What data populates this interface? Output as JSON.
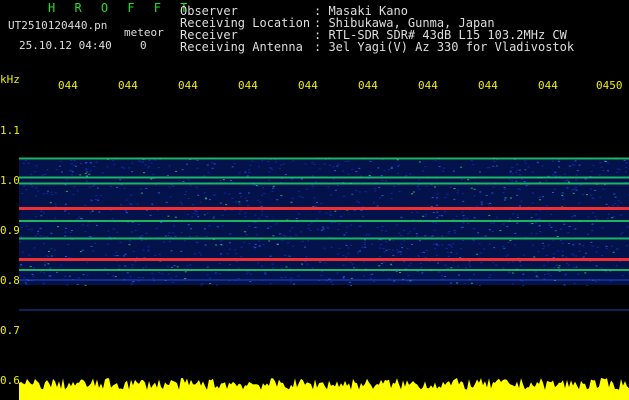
{
  "header": {
    "app_name": "H R O F F T",
    "filename": "UT2510120440.pn",
    "tag": "meteor",
    "datetime": "25.10.12 04:40",
    "count": "0"
  },
  "meta": [
    {
      "key": "Observer",
      "value": ": Masaki Kano"
    },
    {
      "key": "Receiving Location",
      "value": ": Shibukawa, Gunma, Japan"
    },
    {
      "key": "Receiver",
      "value": ": RTL-SDR SDR# 43dB L15 103.2MHz CW"
    },
    {
      "key": "Receiving Antenna",
      "value": ": 3el Yagi(V) Az 330 for Vladivostok"
    }
  ],
  "colors": {
    "text": "#dddddd",
    "title": "#22dd22",
    "axis_labels": "#eeee00",
    "background": "#000000",
    "signal_strong": "#ff3030",
    "signal_mid": "#22dd66",
    "noise": "#1030c0",
    "bottom_trace": "#ffff00"
  },
  "chart_data": {
    "type": "heatmap",
    "ylabel": "kHz",
    "y_ticks": [
      "1.1",
      "1.0",
      "0.9",
      "0.8",
      "0.7",
      "0.6"
    ],
    "x_ticks": [
      "044",
      "044",
      "044",
      "044",
      "044",
      "044",
      "044",
      "044",
      "044",
      "0450"
    ],
    "ylim": [
      0.6,
      1.1
    ],
    "bands_khz": [
      {
        "freq": 1.043,
        "strength": "mid"
      },
      {
        "freq": 1.005,
        "strength": "mid"
      },
      {
        "freq": 0.993,
        "strength": "mid"
      },
      {
        "freq": 0.943,
        "strength": "strong"
      },
      {
        "freq": 0.918,
        "strength": "mid"
      },
      {
        "freq": 0.883,
        "strength": "mid"
      },
      {
        "freq": 0.841,
        "strength": "strong"
      },
      {
        "freq": 0.82,
        "strength": "mid"
      },
      {
        "freq": 0.8,
        "strength": "weak"
      },
      {
        "freq": 0.74,
        "strength": "weak"
      }
    ]
  }
}
